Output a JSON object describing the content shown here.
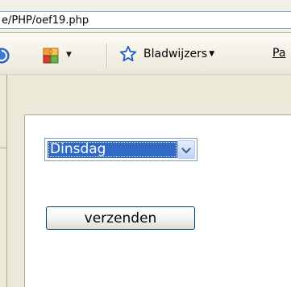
{
  "address_bar": {
    "url_text": "e/PHP/oef19.php"
  },
  "toolbar": {
    "bookmarks_label": "Bladwijzers",
    "next_item_label": "Pa",
    "icons": [
      "circle-arrow-icon",
      "puzzle-icon",
      "star-outline-icon"
    ]
  },
  "form": {
    "day_select": {
      "selected_value": "Dinsdag"
    },
    "submit_label": "verzenden"
  },
  "colors": {
    "selection_bg": "#316ac5",
    "field_border": "#7f9db9",
    "button_border": "#003c74",
    "chrome_bg": "#ece9d8"
  }
}
